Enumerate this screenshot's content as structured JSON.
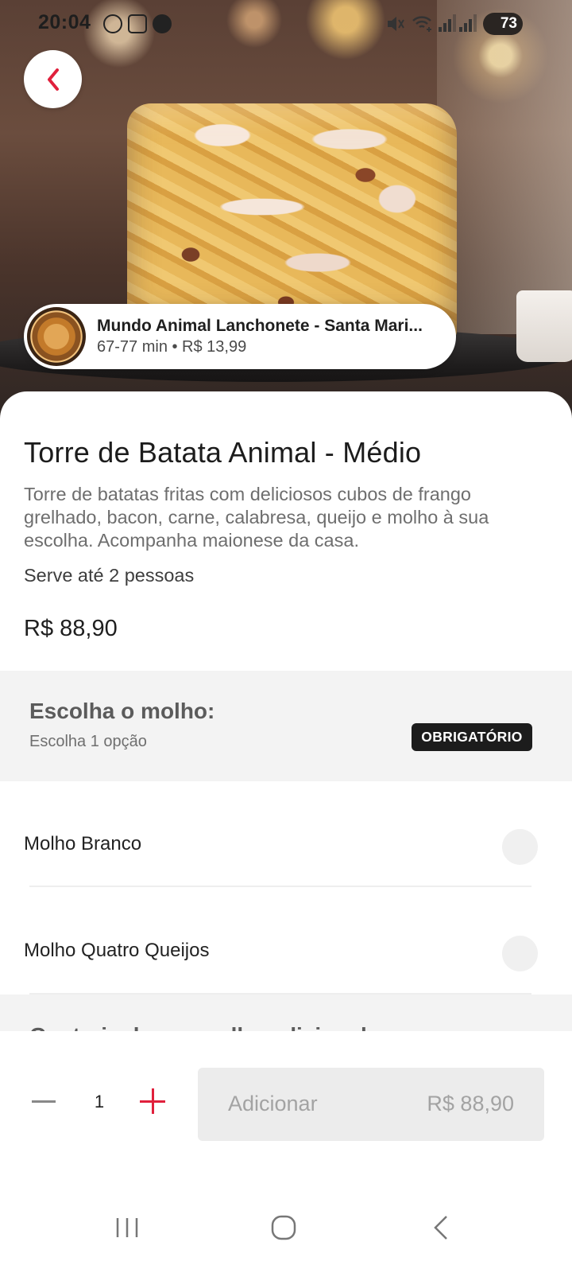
{
  "status_bar": {
    "time": "20:04",
    "battery": "73"
  },
  "hero": {
    "image": "fries-tower-photo"
  },
  "store": {
    "name": "Mundo Animal Lanchonete - Santa Mari...",
    "meta": "67-77 min • R$ 13,99"
  },
  "product": {
    "title": "Torre de Batata Animal - Médio",
    "description": "Torre de batatas fritas com deliciosos cubos de frango grelhado, bacon, carne, calabresa, queijo e molho à sua escolha. Acompanha maionese da casa.",
    "serves": "Serve até 2 pessoas",
    "price": "R$ 88,90"
  },
  "group": {
    "title": "Escolha o molho:",
    "subtitle": "Escolha 1 opção",
    "badge": "OBRIGATÓRIO",
    "options": [
      {
        "label": "Molho Branco"
      },
      {
        "label": "Molho Quatro Queijos"
      }
    ]
  },
  "next_group": {
    "title": "Gostaria de um molho adicional"
  },
  "action_bar": {
    "quantity": "1",
    "add_label": "Adicionar",
    "add_price": "R$ 88,90"
  },
  "colors": {
    "accent": "#E0203C",
    "badge_bg": "#1C1C1C",
    "disabled_bg": "#ECECEC"
  }
}
